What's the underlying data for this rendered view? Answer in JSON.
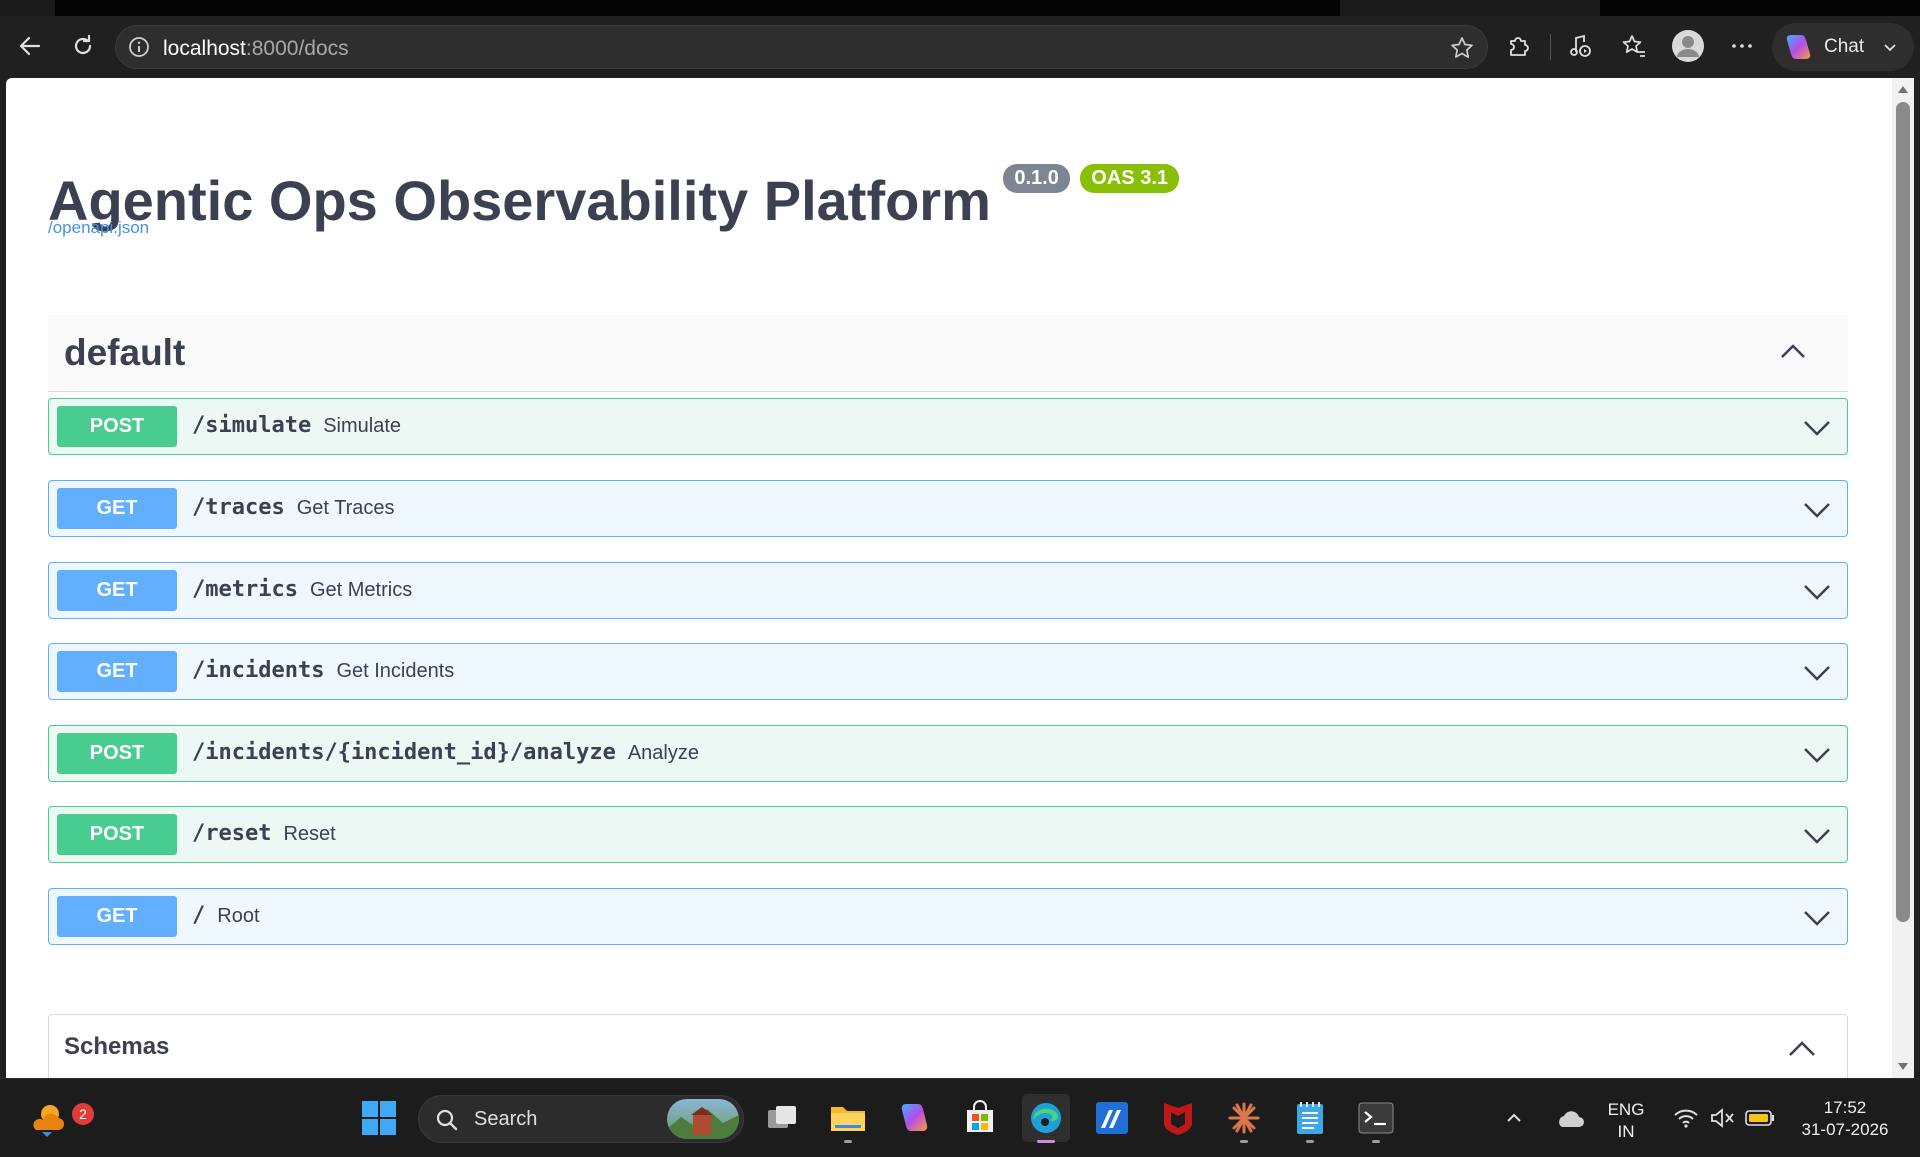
{
  "browser": {
    "url_host": "localhost",
    "url_rest": ":8000/docs",
    "chat_label": "Chat"
  },
  "page": {
    "title": "Agentic Ops Observability Platform",
    "version_badge": "0.1.0",
    "oas_badge": "OAS 3.1",
    "spec_link": "/openapi.json",
    "tag": "default",
    "schemas_label": "Schemas"
  },
  "operations": [
    {
      "method": "POST",
      "path": "/simulate",
      "summary": "Simulate"
    },
    {
      "method": "GET",
      "path": "/traces",
      "summary": "Get Traces"
    },
    {
      "method": "GET",
      "path": "/metrics",
      "summary": "Get Metrics"
    },
    {
      "method": "GET",
      "path": "/incidents",
      "summary": "Get Incidents"
    },
    {
      "method": "POST",
      "path": "/incidents/{incident_id}/analyze",
      "summary": "Analyze"
    },
    {
      "method": "POST",
      "path": "/reset",
      "summary": "Reset"
    },
    {
      "method": "GET",
      "path": "/",
      "summary": "Root"
    }
  ],
  "colors": {
    "post": "#49cc90",
    "get": "#61affe",
    "oas": "#89bf04",
    "version": "#7d8492",
    "link": "#4990e2"
  },
  "taskbar": {
    "search_label": "Search",
    "notification_count": "2",
    "lang_line1": "ENG",
    "lang_line2": "IN",
    "time": "17:52",
    "date": "31-07-2026",
    "apps": [
      "weather-icon",
      "start-icon",
      "search",
      "task-view-icon",
      "file-explorer-icon",
      "copilot-icon",
      "store-icon",
      "edge-icon",
      "app-icon",
      "mcafee-icon",
      "claude-icon",
      "notepad-icon",
      "terminal-icon"
    ]
  }
}
